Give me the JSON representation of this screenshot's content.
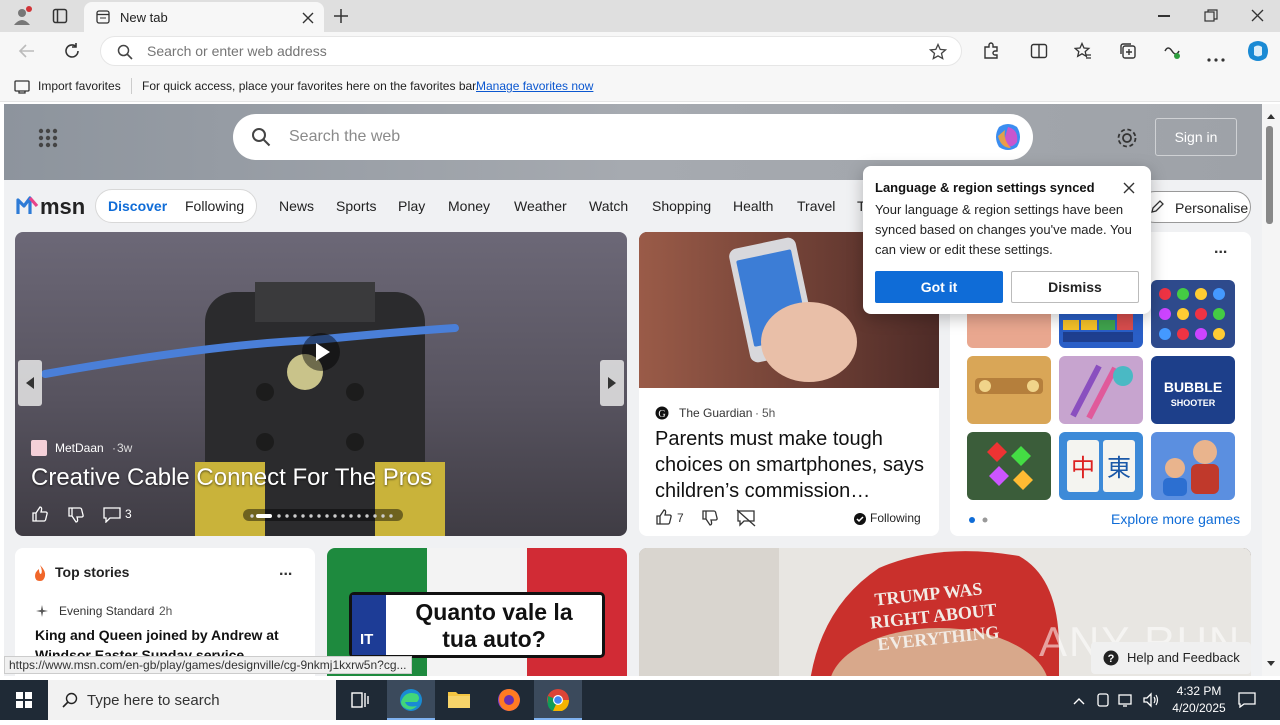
{
  "browser": {
    "tab_title": "New tab",
    "new_tab_label": "+",
    "address_placeholder": "Search or enter web address"
  },
  "favorites_bar": {
    "import_label": "Import favorites",
    "hint_text": "For quick access, place your favorites here on the favorites bar.",
    "manage_link": "Manage favorites now"
  },
  "msn": {
    "search_placeholder": "Search the web",
    "sign_in": "Sign in",
    "logo": "msn",
    "toggle": {
      "discover": "Discover",
      "following": "Following"
    },
    "nav": [
      "News",
      "Sports",
      "Play",
      "Money",
      "Weather",
      "Watch",
      "Shopping",
      "Health",
      "Travel",
      "T"
    ],
    "personalise": "Personalise"
  },
  "hero": {
    "source": "MetDaan",
    "age": "3w",
    "headline": "Creative Cable Connect For The Pros",
    "comments": "3"
  },
  "guardian": {
    "source": "The Guardian",
    "age": "5h",
    "headline": "Parents must make tough choices on smartphones, says children’s commission…",
    "likes": "7",
    "following": "Following"
  },
  "games": {
    "more": "...",
    "explore": "Explore more games",
    "tile_colors": [
      "#e9a78f",
      "#2a5fc7",
      "#2e4a8c",
      "#d9a657",
      "#c7a4cf",
      "#1d3f8a",
      "#3b5d3a",
      "#3d8ad8",
      "#5b8fe0"
    ],
    "bubble_text": "BUBBLE SHOOTER"
  },
  "top_stories": {
    "title": "Top stories",
    "more": "...",
    "source": "Evening Standard",
    "age": "2h",
    "headline": "King and Queen joined by Andrew at Windsor Easter Sunday service"
  },
  "ad": {
    "badge": "IT",
    "text": "Quanto vale la tua auto?"
  },
  "big_card": {
    "hat_text": "TRUMP WAS RIGHT ABOUT EVERYTHING"
  },
  "popup": {
    "title": "Language & region settings synced",
    "body": "Your language & region settings have been synced based on changes you've made. You can view or edit these settings.",
    "got_it": "Got it",
    "dismiss": "Dismiss"
  },
  "help": "Help and Feedback",
  "status_url": "https://www.msn.com/en-gb/play/games/designville/cg-9nkmj1kxrw5n?cg...",
  "watermark": "ANY RUN",
  "taskbar": {
    "search_placeholder": "Type here to search",
    "time": "4:32 PM",
    "date": "4/20/2025"
  }
}
